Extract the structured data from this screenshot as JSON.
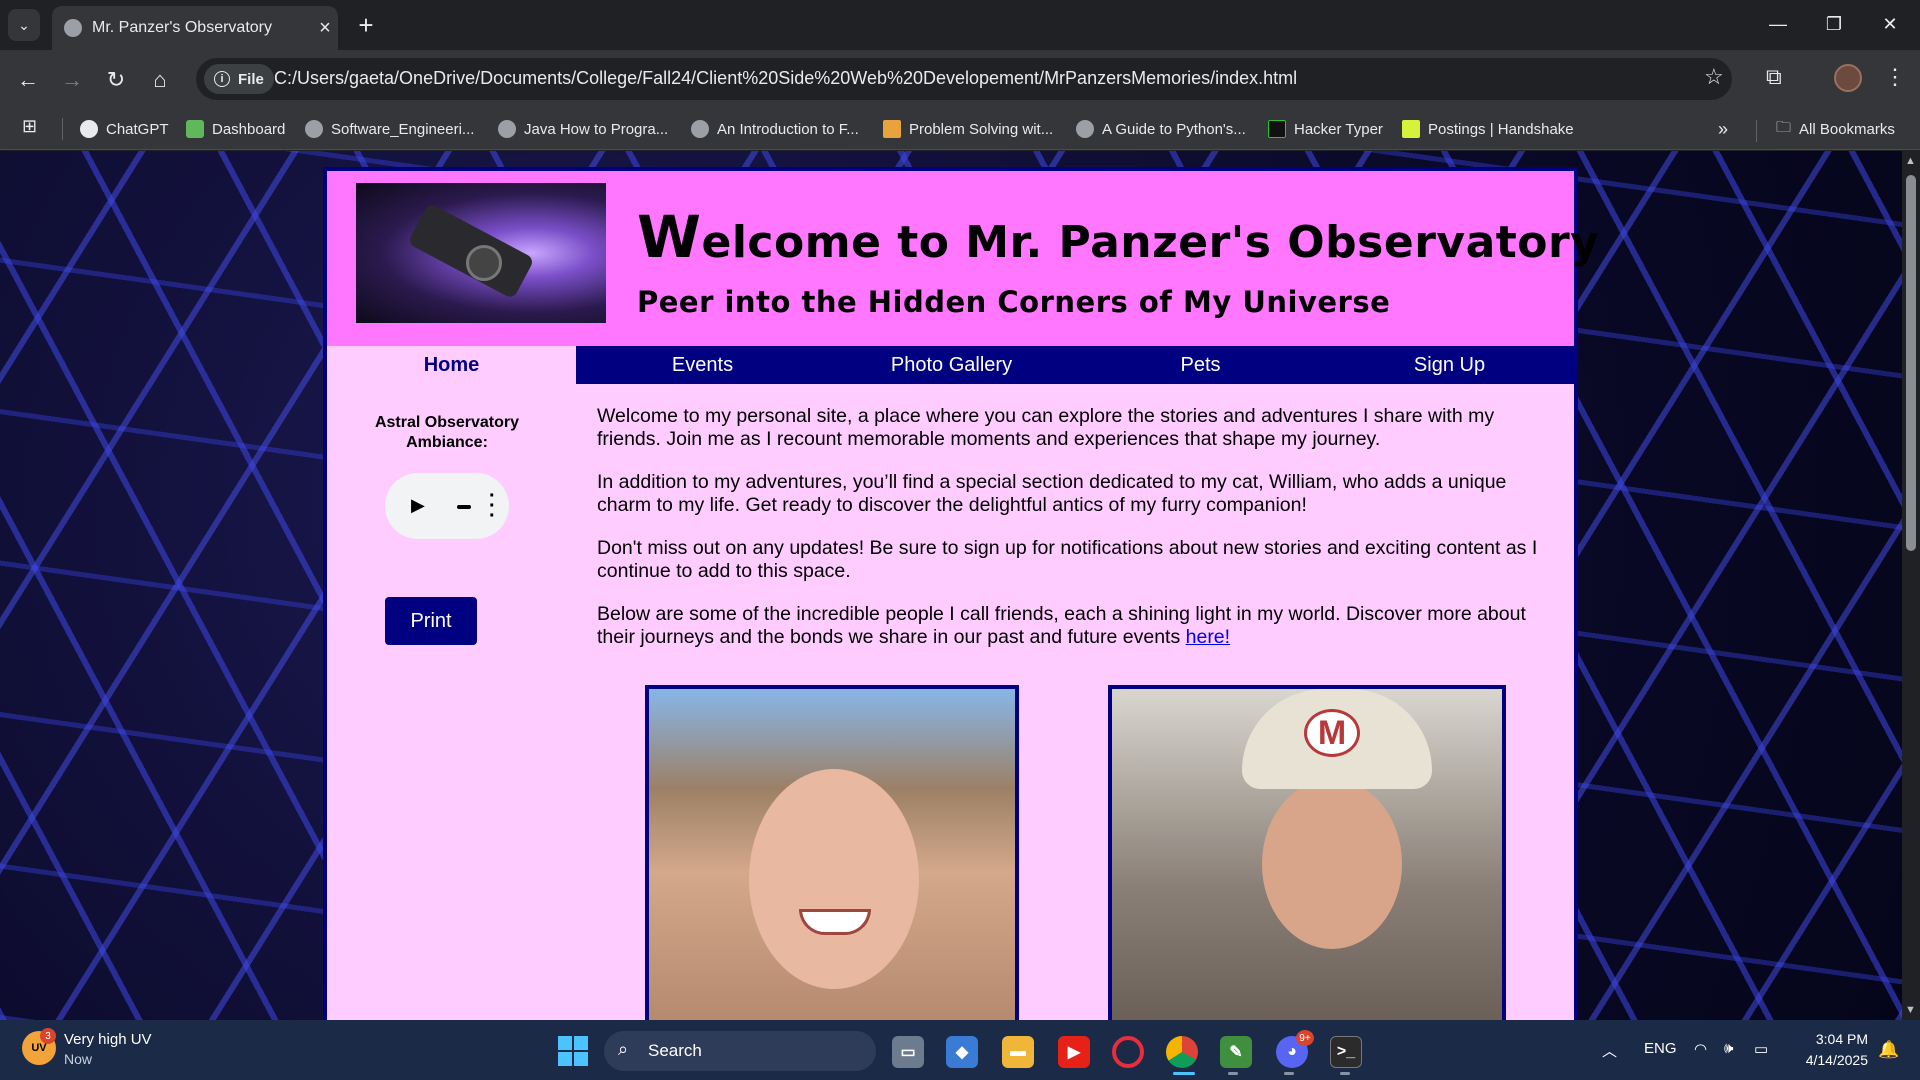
{
  "browser": {
    "tab_title": "Mr. Panzer's Observatory",
    "tab_close": "×",
    "new_tab": "+",
    "file_chip": "File",
    "url": "C:/Users/gaeta/OneDrive/Documents/College/Fall24/Client%20Side%20Web%20Developement/MrPanzersMemories/index.html",
    "bookmarks": [
      {
        "label": "ChatGPT",
        "icon": "chatgpt-icon",
        "color": "#e8eaed"
      },
      {
        "label": "Dashboard",
        "icon": "dashboard-icon",
        "color": "#5fb85a"
      },
      {
        "label": "Software_Engineeri...",
        "icon": "globe-icon",
        "color": "#9aa0a6"
      },
      {
        "label": "Java How to Progra...",
        "icon": "globe-icon",
        "color": "#9aa0a6"
      },
      {
        "label": "An Introduction to F...",
        "icon": "globe-icon",
        "color": "#9aa0a6"
      },
      {
        "label": "Problem Solving wit...",
        "icon": "triangle-icon",
        "color": "#e8a33d"
      },
      {
        "label": "A Guide to Python's...",
        "icon": "globe-icon",
        "color": "#9aa0a6"
      },
      {
        "label": "Hacker Typer",
        "icon": "terminal-icon",
        "color": "#1a1a1a"
      },
      {
        "label": "Postings | Handshake",
        "icon": "handshake-icon",
        "color": "#d7f23a"
      }
    ],
    "more_bookmarks": "»",
    "all_bookmarks": "All Bookmarks"
  },
  "site": {
    "title_first": "W",
    "title_rest": "elcome to Mr. Panzer's Observatory",
    "subtitle": "Peer into the Hidden Corners of My Universe",
    "nav": [
      "Home",
      "Events",
      "Photo Gallery",
      "Pets",
      "Sign Up"
    ],
    "sidebar_label": "Astral Observatory Ambiance:",
    "print_label": "Print",
    "paragraphs": [
      "Welcome to my personal site, a place where you can explore the stories and adventures I share with my friends. Join me as I recount memorable moments and experiences that shape my journey.",
      "In addition to my adventures, you’ll find a special section dedicated to my cat, William, who adds a unique charm to my life. Get ready to discover the delightful antics of my furry companion!",
      "Don't miss out on any updates! Be sure to sign up for notifications about new stories and exciting content as I continue to add to this space."
    ],
    "last_paragraph_text": "Below are some of the incredible people I call friends, each a shining light in my world. Discover more about their journeys and the bonds we share in our past and future events ",
    "link_text": "here!",
    "hat_letter": "M"
  },
  "taskbar": {
    "weather_title": "Very high UV",
    "weather_sub": "Now",
    "weather_icon_text": "UV",
    "weather_badge": "3",
    "search_label": "Search",
    "language": "ENG",
    "time": "3:04 PM",
    "date": "4/14/2025",
    "discord_badge": "9+"
  },
  "colors": {
    "site_bg": "#ffccff",
    "header_bg": "#ff77ff",
    "nav_bg": "#000080",
    "accent_link": "#0000ee"
  }
}
